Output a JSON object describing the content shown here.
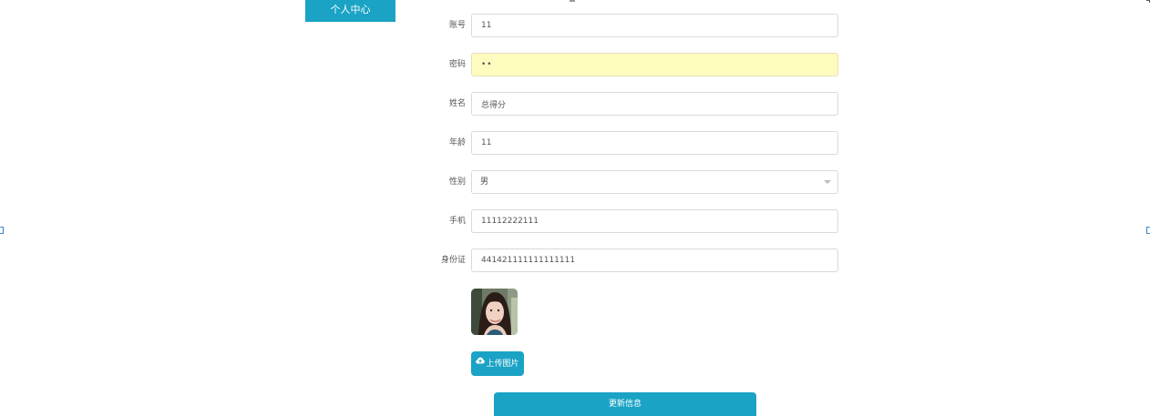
{
  "sidebar": {
    "active_label": "个人中心"
  },
  "form": {
    "fields": [
      {
        "label": "账号",
        "value": "11"
      },
      {
        "label": "密码",
        "value": "••"
      },
      {
        "label": "姓名",
        "value": "总得分"
      },
      {
        "label": "年龄",
        "value": "11"
      },
      {
        "label": "性别",
        "value": "男"
      },
      {
        "label": "手机",
        "value": "11112222111"
      },
      {
        "label": "身份证",
        "value": "441421111111111111"
      }
    ],
    "gender_options": [
      "男"
    ],
    "upload_label": "上传图片",
    "upload_icon": "cloud-upload-icon",
    "submit_label": "更新信息"
  },
  "colors": {
    "accent": "#1aa3c5",
    "password_bg": "#fdfbbe",
    "border": "#d9d9d9"
  }
}
